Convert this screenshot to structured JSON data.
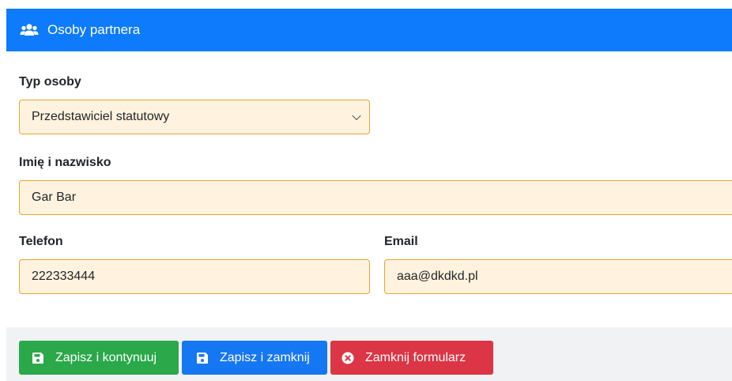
{
  "header": {
    "icon": "users-icon",
    "title": "Osoby partnera"
  },
  "form": {
    "person_type": {
      "label": "Typ osoby",
      "selected": "Przedstawiciel statutowy"
    },
    "full_name": {
      "label": "Imię i nazwisko",
      "value": "Gar Bar"
    },
    "phone": {
      "label": "Telefon",
      "value": "222333444"
    },
    "email": {
      "label": "Email",
      "value": "aaa@dkdkd.pl"
    }
  },
  "actions": {
    "save_continue": "Zapisz i kontynuuj",
    "save_close": "Zapisz i zamknij",
    "close_form": "Zamknij formularz"
  },
  "colors": {
    "header": "#0d7bfb",
    "field_bg": "#fff3df",
    "field_border": "#e6a530",
    "save_continue": "#2aa84a",
    "save_close": "#1677f2",
    "close_form": "#dc3545"
  }
}
